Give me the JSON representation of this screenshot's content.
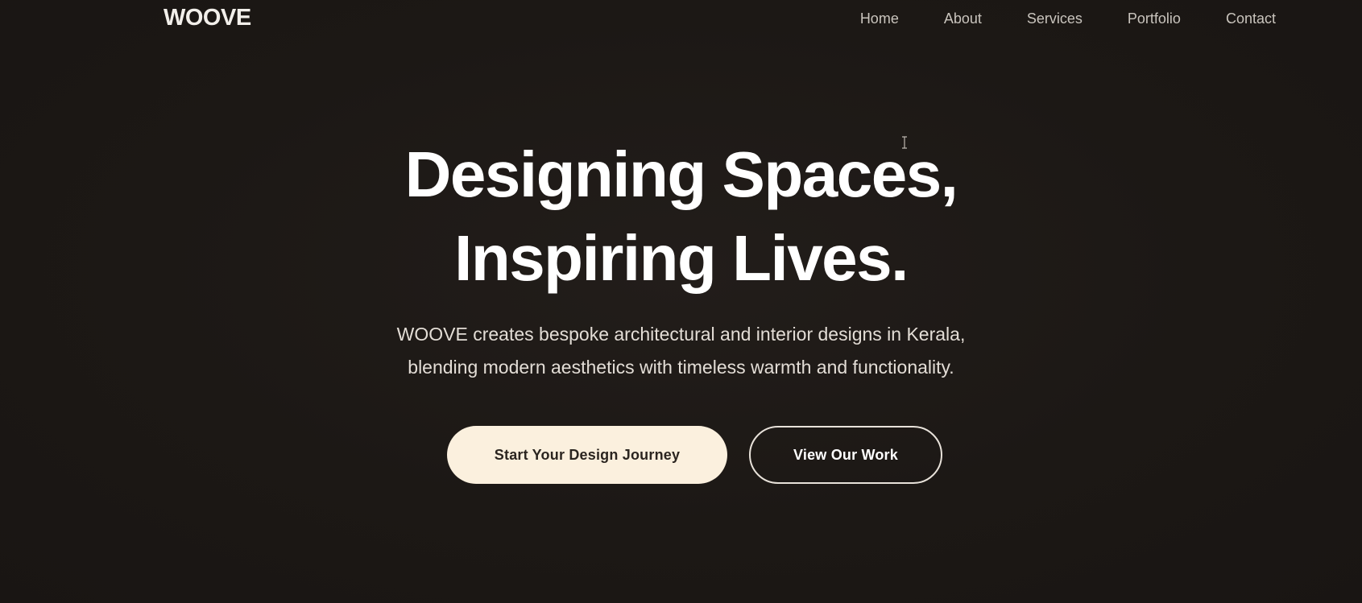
{
  "header": {
    "logo": "WOOVE",
    "nav": [
      {
        "label": "Home"
      },
      {
        "label": "About"
      },
      {
        "label": "Services"
      },
      {
        "label": "Portfolio"
      },
      {
        "label": "Contact"
      }
    ]
  },
  "hero": {
    "title_line1": "Designing Spaces,",
    "title_line2": "Inspiring Lives.",
    "subtitle_line1": "WOOVE creates bespoke architectural and interior designs in Kerala,",
    "subtitle_line2": "blending modern aesthetics with timeless warmth and functionality.",
    "primary_button": "Start Your Design Journey",
    "secondary_button": "View Our Work"
  },
  "colors": {
    "background": "#1c1815",
    "primary_button_bg": "#fbf0de",
    "text": "#ffffff"
  },
  "cursor": {
    "icon": "text-cursor-icon"
  }
}
